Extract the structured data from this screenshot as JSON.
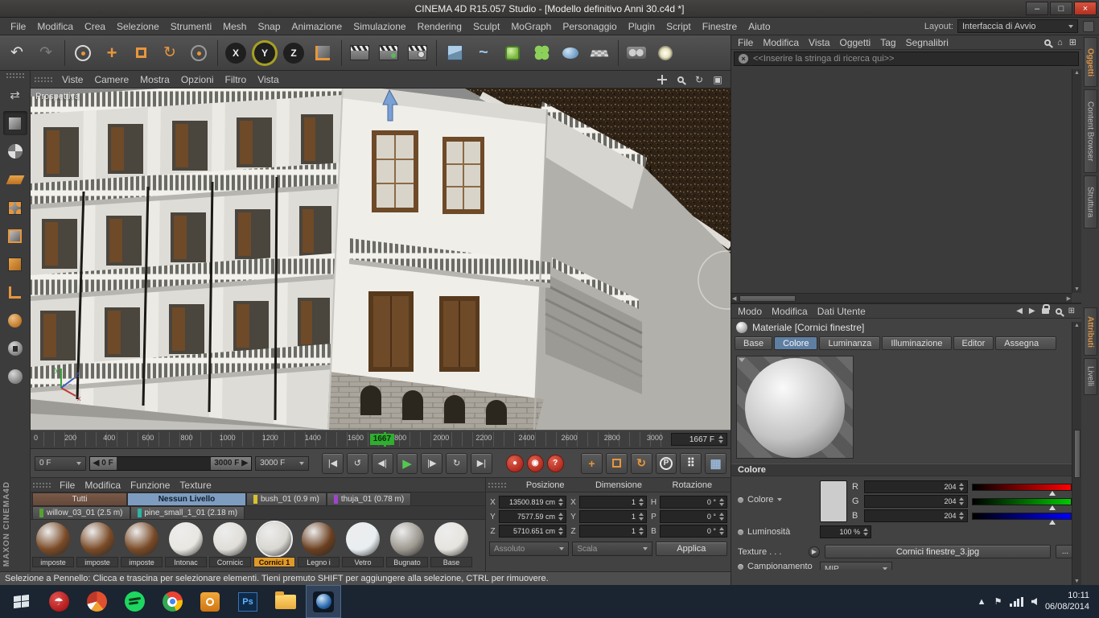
{
  "title_bar": {
    "title": "CINEMA 4D R15.057 Studio - [Modello definitivo Anni 30.c4d *]",
    "minimize": "–",
    "maximize": "□",
    "close": "×"
  },
  "menu_bar": {
    "items": [
      "File",
      "Modifica",
      "Crea",
      "Selezione",
      "Strumenti",
      "Mesh",
      "Snap",
      "Animazione",
      "Simulazione",
      "Rendering",
      "Sculpt",
      "MoGraph",
      "Personaggio",
      "Plugin",
      "Script",
      "Finestre",
      "Aiuto"
    ],
    "layout_label": "Layout:",
    "layout_value": "Interfaccia di Avvio"
  },
  "toolbar": {
    "axis_x": "X",
    "axis_y": "Y",
    "axis_z": "Z",
    "icon_names": [
      "undo-icon",
      "redo-icon",
      "live-selection-icon",
      "move-tool-icon",
      "scale-tool-icon",
      "rotate-tool-icon",
      "last-tool-icon",
      "coordinate-system-icon",
      "render-view-icon",
      "render-picture-viewer-icon",
      "render-settings-icon",
      "add-primitive-icon",
      "spline-pen-icon",
      "subdivision-surface-icon",
      "cloner-icon",
      "metaball-icon",
      "floor-icon",
      "camera-icon",
      "light-icon"
    ],
    "undo_glyph": "↶",
    "redo_glyph": "↷",
    "rotate_glyph": "↻"
  },
  "left_toolbar": {
    "brand": "MAXON CINEMA4D",
    "icon_names": [
      "make-editable-icon",
      "model-mode-icon",
      "texture-mode-icon",
      "workplane-mode-icon",
      "points-mode-icon",
      "edges-mode-icon",
      "polygons-mode-icon",
      "axis-mode-icon",
      "sculpt-icon",
      "lock-sphere-icon",
      "snap-sphere-icon"
    ]
  },
  "viewport": {
    "menus": [
      "Viste",
      "Camere",
      "Mostra",
      "Opzioni",
      "Filtro",
      "Vista"
    ],
    "label": "Prospettiva",
    "nav_icon_names": [
      "pan-view-icon",
      "zoom-view-icon",
      "rotate-view-icon",
      "toggle-view-icon"
    ],
    "rotate_glyph": "↻",
    "maximize_glyph": "▣"
  },
  "timeline": {
    "ticks": [
      "0",
      "200",
      "400",
      "600",
      "800",
      "1000",
      "1200",
      "1400",
      "1600",
      "1800",
      "2000",
      "2200",
      "2400",
      "2600",
      "2800",
      "3000"
    ],
    "marker_label": "1667",
    "frame_field": "1667 F"
  },
  "transport": {
    "start_value": "0 F",
    "range_start": "0 F",
    "range_end": "3000 F",
    "end_value": "3000 F",
    "buttons": [
      "|◀",
      "↺",
      "◀|",
      "▶",
      "|▶",
      "↻",
      "▶|"
    ],
    "button_names": [
      "goto-start-button",
      "prev-key-button",
      "prev-frame-button",
      "play-button",
      "next-frame-button",
      "next-key-button",
      "goto-end-button"
    ],
    "record_buttons": [
      "●",
      "◉",
      "?"
    ],
    "record_button_names": [
      "record-keyframe-button",
      "autokey-button",
      "keying-options-button"
    ],
    "tool_buttons": [
      "+",
      "",
      "↻",
      "P",
      "⠿",
      "▦"
    ],
    "tool_button_names": [
      "move-lock-button",
      "scale-lock-button",
      "rotate-lock-button",
      "parent-mode-button",
      "keyframe-dots-button",
      "keyframe-grid-button"
    ]
  },
  "material_manager": {
    "menus": [
      "File",
      "Modifica",
      "Funzione",
      "Texture"
    ],
    "layer_tabs": [
      {
        "label": "Tutti",
        "chip": ""
      },
      {
        "label": "Nessun Livello",
        "chip": ""
      },
      {
        "label": "bush_01 (0.9 m)",
        "chip": "#d8c32c"
      },
      {
        "label": "thuja_01 (0.78 m)",
        "chip": "#a044cc"
      },
      {
        "label": "willow_03_01 (2.5 m)",
        "chip": "#55a232"
      },
      {
        "label": "pine_small_1_01 (2.18 m)",
        "chip": "#2cb4a4"
      }
    ],
    "items": [
      {
        "name": "imposte",
        "color": "#7a4a26"
      },
      {
        "name": "imposte",
        "color": "#7a4a26"
      },
      {
        "name": "imposte",
        "color": "#7a4a26"
      },
      {
        "name": "Intonac",
        "color": "#e9e7e1"
      },
      {
        "name": "Cornicic",
        "color": "#e0ded8"
      },
      {
        "name": "Cornici 1",
        "color": "#d9d7d1"
      },
      {
        "name": "Legno i",
        "color": "#6b3f1f"
      },
      {
        "name": "Vetro",
        "color": "#e9eff1"
      },
      {
        "name": "Bugnato",
        "color": "#9c988f"
      },
      {
        "name": "Base",
        "color": "#e6e4de"
      }
    ]
  },
  "coordinates": {
    "headers": [
      "Posizione",
      "Dimensione",
      "Rotazione"
    ],
    "position": [
      {
        "axis": "X",
        "value": "13500.819 cm"
      },
      {
        "axis": "Y",
        "value": "7577.59 cm"
      },
      {
        "axis": "Z",
        "value": "5710.651 cm"
      }
    ],
    "dimension": [
      {
        "axis": "X",
        "value": "1"
      },
      {
        "axis": "Y",
        "value": "1"
      },
      {
        "axis": "Z",
        "value": "1"
      }
    ],
    "rotation": [
      {
        "axis": "H",
        "value": "0 °"
      },
      {
        "axis": "P",
        "value": "0 °"
      },
      {
        "axis": "B",
        "value": "0 °"
      }
    ],
    "mode_absolute": "Assoluto",
    "mode_scale": "Scala",
    "apply_label": "Applica"
  },
  "object_manager": {
    "menus": [
      "File",
      "Modifica",
      "Vista",
      "Oggetti",
      "Tag",
      "Segnalibri"
    ],
    "search_placeholder": "<<Inserire la stringa di ricerca qui>>",
    "icon_names": [
      "search-icon",
      "home-icon",
      "add-icon"
    ]
  },
  "side_tabs": {
    "top": [
      "Oggetti",
      "Content Browser",
      "Struttura"
    ],
    "bottom": [
      "Attributi",
      "Livelli"
    ]
  },
  "attribute_manager": {
    "menus": [
      "Modo",
      "Modifica",
      "Dati Utente"
    ],
    "object_title": "Materiale [Cornici finestre]",
    "tabs": [
      "Base",
      "Colore",
      "Luminanza",
      "Illuminazione",
      "Editor"
    ],
    "tabs_row2": [
      "Assegna"
    ],
    "active_tab": "Colore",
    "section_header": "Colore",
    "color_label": "Colore",
    "channels": [
      {
        "label": "R",
        "value": "204",
        "color": "#ff0000"
      },
      {
        "label": "G",
        "value": "204",
        "color": "#00c800"
      },
      {
        "label": "B",
        "value": "204",
        "color": "#0000ff"
      }
    ],
    "brightness_label": "Luminosità",
    "brightness_value": "100 %",
    "texture_label": "Texture . . .",
    "texture_value": "Cornici finestre_3.jpg",
    "texture_browse": "...",
    "clipped_row_label": "Campionamento",
    "clipped_row_value": "MIP"
  },
  "status_bar": {
    "text": "Selezione a Pennello: Clicca e trascina per selezionare elementi. Tieni premuto SHIFT per aggiungere alla selezione, CTRL per rimuovere."
  },
  "taskbar": {
    "time": "10:11",
    "date": "06/08/2014",
    "app_icon_names": [
      "start-button",
      "avira-icon",
      "pie-chart-app-icon",
      "spotify-icon",
      "chrome-icon",
      "orange-app-icon",
      "photoshop-icon",
      "file-explorer-icon",
      "cinema4d-icon"
    ],
    "tray_icon_names": [
      "tray-expand-icon",
      "flag-icon",
      "network-icon",
      "volume-icon"
    ],
    "tray_expand_glyph": "▲",
    "flag_glyph": "⚑"
  }
}
